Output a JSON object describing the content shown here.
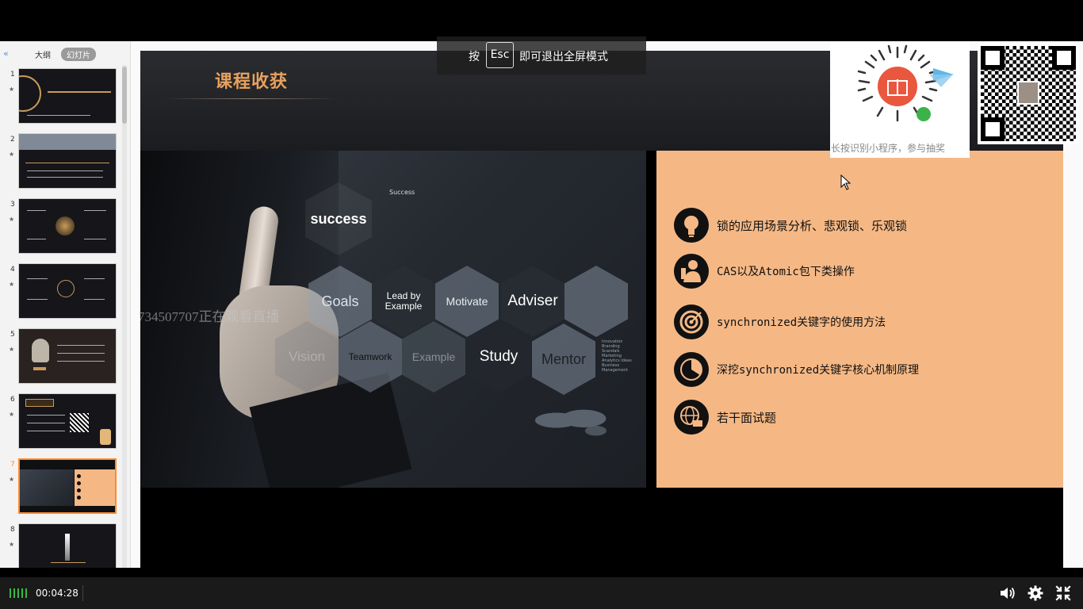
{
  "panel": {
    "collapse_glyph": "«",
    "tabs": [
      {
        "label": "大纲"
      },
      {
        "label": "幻灯片"
      }
    ],
    "thumbnails": [
      {
        "num": "1",
        "star": "★"
      },
      {
        "num": "2",
        "star": "★"
      },
      {
        "num": "3",
        "star": "★"
      },
      {
        "num": "4",
        "star": "★"
      },
      {
        "num": "5",
        "star": "★"
      },
      {
        "num": "6",
        "star": "★"
      },
      {
        "num": "7",
        "star": "★",
        "active": true
      },
      {
        "num": "8",
        "star": "★"
      }
    ]
  },
  "slide": {
    "title": "课程收获",
    "image_words": {
      "success": "success",
      "success_logo": "Success",
      "goals": "Goals",
      "lead": "Lead by Example",
      "motivate": "Motivate",
      "adviser": "Adviser",
      "vision": "Vision",
      "teamwork": "Teamwork",
      "example": "Example",
      "study": "Study",
      "mentor": "Mentor",
      "mentor_list": "Innovation Branding Scandals Marketing Analytics Ideas Business Management"
    },
    "points": [
      {
        "text": "锁的应用场景分析、悲观锁、乐观锁",
        "icon": "lightbulb-icon"
      },
      {
        "text": "CAS以及Atomic包下类操作",
        "icon": "person-icon"
      },
      {
        "text": "synchronized关键字的使用方法",
        "icon": "target-icon"
      },
      {
        "text": "深挖synchronized关键字核心机制原理",
        "icon": "pie-chart-icon"
      },
      {
        "text": "若干面试题",
        "icon": "globe-icon"
      }
    ]
  },
  "watermark": "734507707正在观看直播",
  "esc_hint": {
    "pre": "按",
    "key": "Esc",
    "post": "即可退出全屏模式"
  },
  "promo": {
    "caption": "长按识别小程序，参与抽奖"
  },
  "player": {
    "time": "00:04:28"
  },
  "colors": {
    "accent": "#e8a15d",
    "panel_right": "#f5b885",
    "active_thumb": "#ff8a2b"
  }
}
